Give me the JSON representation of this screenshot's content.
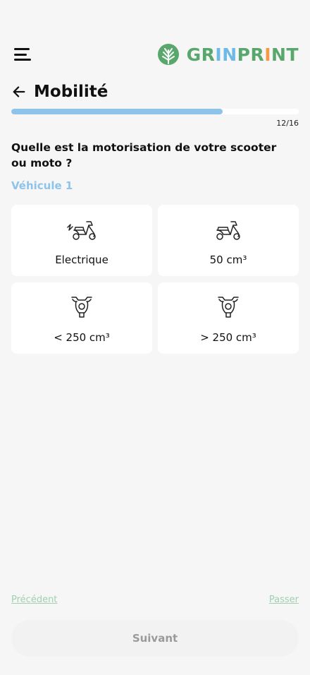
{
  "header": {
    "menu_icon": "hamburger-menu-icon",
    "logo_icon": "tree-leaf-logo-icon",
    "logo_parts": [
      {
        "text": "GR",
        "color": "#5aa76d"
      },
      {
        "text": "IN",
        "color": "#6fb9e6"
      },
      {
        "text": "PR",
        "color": "#5aa76d"
      },
      {
        "text": "I",
        "color": "#f2994a"
      },
      {
        "text": "NT",
        "color": "#5aa76d"
      }
    ]
  },
  "page": {
    "back_icon": "arrow-left-icon",
    "title": "Mobilité"
  },
  "progress": {
    "current": 12,
    "total": 16,
    "label": "12/16",
    "fill_fraction": 0.735,
    "color": "#8ec4ea"
  },
  "question": {
    "text": "Quelle est la motorisation de votre scooter ou moto ?",
    "vehicle_label": "Véhicule 1"
  },
  "options": [
    {
      "label": "Electrique",
      "icon": "electric-scooter-icon"
    },
    {
      "label": "50 cm³",
      "icon": "scooter-icon"
    },
    {
      "label": "< 250 cm³",
      "icon": "motorcycle-front-icon"
    },
    {
      "label": "> 250 cm³",
      "icon": "motorcycle-front-icon"
    }
  ],
  "footer": {
    "previous_label": "Précédent",
    "skip_label": "Passer",
    "next_label": "Suivant"
  }
}
